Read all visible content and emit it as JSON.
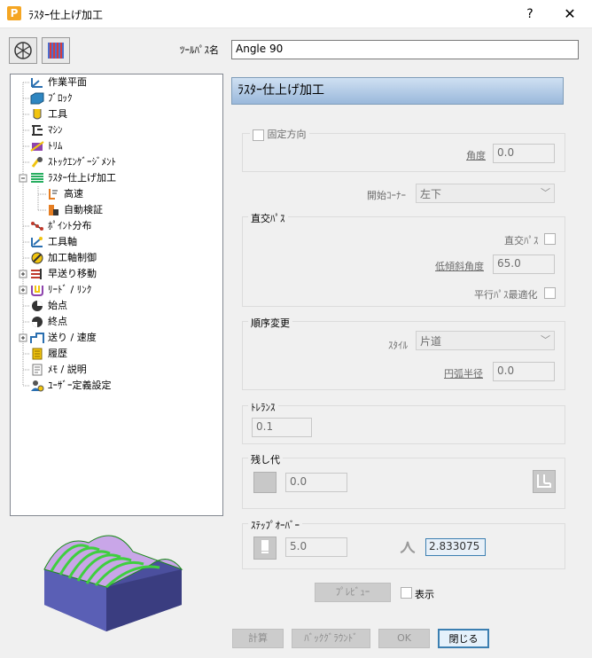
{
  "window": {
    "title": "ﾗｽﾀｰ仕上げ加工",
    "help": "?",
    "close": "✕",
    "app_letter": "P"
  },
  "toolpath_name": {
    "label": "ﾂｰﾙﾊﾟｽ名",
    "value": "Angle 90"
  },
  "tree": {
    "items": [
      {
        "label": "作業平面"
      },
      {
        "label": "ﾌﾞﾛｯｸ"
      },
      {
        "label": "工具"
      },
      {
        "label": "ﾏｼﾝ"
      },
      {
        "label": "ﾄﾘﾑ"
      },
      {
        "label": "ｽﾄｯｸｴﾝｹﾞｰｼﾞﾒﾝﾄ"
      },
      {
        "label": "ﾗｽﾀｰ仕上げ加工"
      },
      {
        "label": "高速"
      },
      {
        "label": "自動検証"
      },
      {
        "label": "ﾎﾟｲﾝﾄ分布"
      },
      {
        "label": "工具軸"
      },
      {
        "label": "加工軸制御"
      },
      {
        "label": "早送り移動"
      },
      {
        "label": "ﾘｰﾄﾞ / ﾘﾝｸ"
      },
      {
        "label": "始点"
      },
      {
        "label": "終点"
      },
      {
        "label": "送り / 速度"
      },
      {
        "label": "履歴"
      },
      {
        "label": "ﾒﾓ / 説明"
      },
      {
        "label": "ﾕｰｻﾞｰ定義設定"
      }
    ]
  },
  "header": {
    "title": "ﾗｽﾀｰ仕上げ加工"
  },
  "fixed_direction": {
    "label": "固定方向",
    "angle_label": "角度",
    "angle_value": "0.0"
  },
  "start_corner": {
    "label": "開始ｺｰﾅｰ",
    "value": "左下"
  },
  "orthogonal": {
    "title": "直交ﾊﾟｽ",
    "check_label": "直交ﾊﾟｽ",
    "low_slope_label": "低傾斜角度",
    "low_slope_value": "65.0",
    "optimize_label": "平行ﾊﾟｽ最適化"
  },
  "order": {
    "title": "順序変更",
    "style_label": "ｽﾀｲﾙ",
    "style_value": "片道",
    "arc_label": "円弧半径",
    "arc_value": "0.0"
  },
  "tolerance": {
    "title": "ﾄﾚﾗﾝｽ",
    "value": "0.1"
  },
  "stock": {
    "title": "残し代",
    "value": "0.0"
  },
  "stepover": {
    "title": "ｽﾃｯﾌﾟｵｰﾊﾞｰ",
    "value": "5.0",
    "cusp_value": "2.833075"
  },
  "preview": {
    "label": "ﾌﾟﾚﾋﾞｭｰ",
    "show_label": "表示"
  },
  "buttons": {
    "calculate": "計算",
    "background": "ﾊﾞｯｸｸﾞﾗｳﾝﾄﾞ",
    "ok": "OK",
    "close": "閉じる"
  }
}
